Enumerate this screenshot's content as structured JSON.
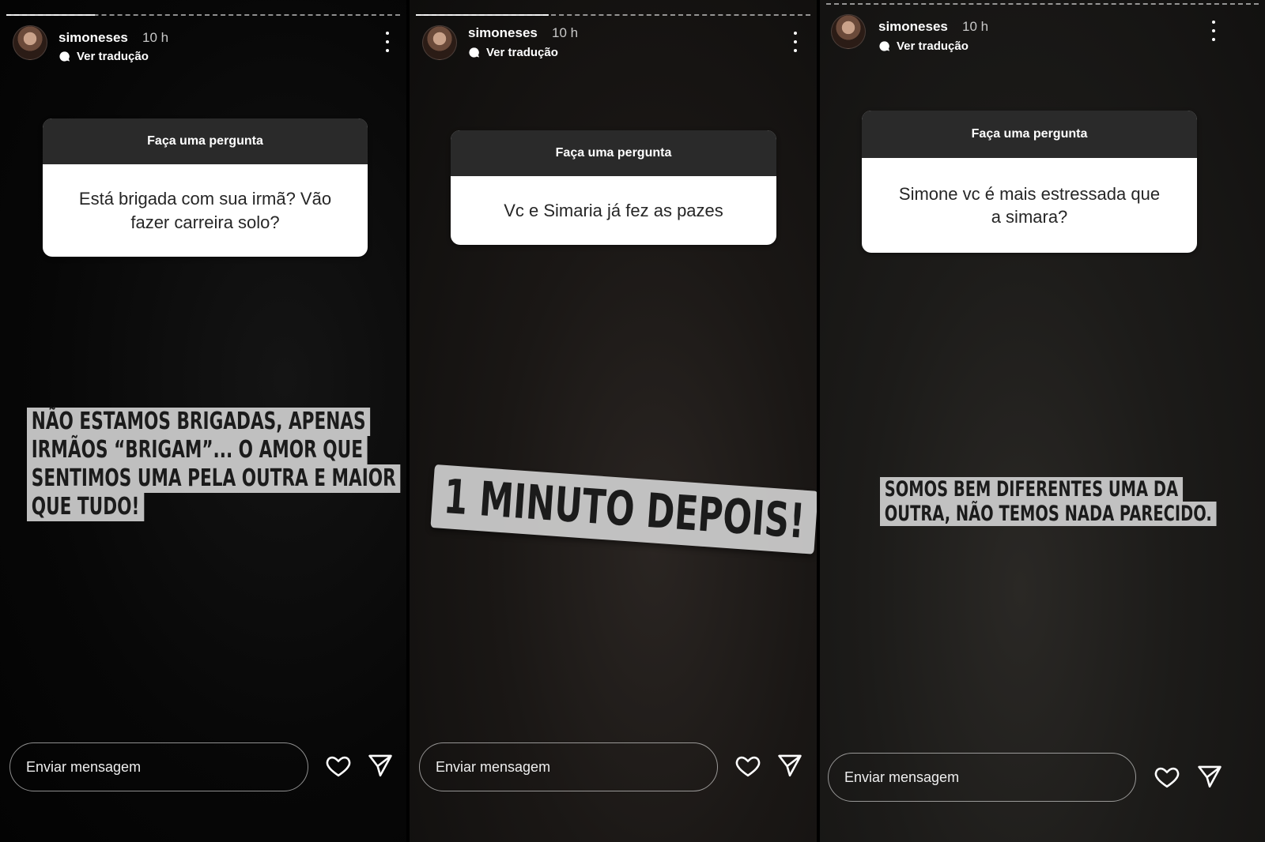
{
  "stories": [
    {
      "username": "simoneses",
      "time": "10 h",
      "translate_label": "Ver tradução",
      "question_header": "Faça uma pergunta",
      "question_text": "Está brigada com sua irmã?  Vão fazer carreira solo?",
      "answer_lines": [
        "NÃO ESTAMOS BRIGADAS, APENAS",
        "IRMÃOS “BRIGAM”... O AMOR QUE",
        "SENTIMOS UMA PELA OUTRA E MAIOR",
        "QUE TUDO!"
      ],
      "message_placeholder": "Enviar mensagem"
    },
    {
      "username": "simoneses",
      "time": "10 h",
      "translate_label": "Ver tradução",
      "question_header": "Faça uma pergunta",
      "question_text": "Vc e Simaria já fez as pazes",
      "answer_lines": [
        "1 MINUTO DEPOIS!"
      ],
      "message_placeholder": "Enviar mensagem"
    },
    {
      "username": "simoneses",
      "time": "10 h",
      "translate_label": "Ver tradução",
      "question_header": "Faça uma pergunta",
      "question_text": "Simone vc é  mais estressada que a simara?",
      "answer_lines": [
        "SOMOS BEM DIFERENTES UMA DA",
        "OUTRA, NÃO TEMOS NADA PARECIDO."
      ],
      "message_placeholder": "Enviar mensagem"
    }
  ],
  "icons": [
    "avatar",
    "translate-bubble-icon",
    "more-options-icon",
    "heart-icon",
    "send-icon"
  ]
}
